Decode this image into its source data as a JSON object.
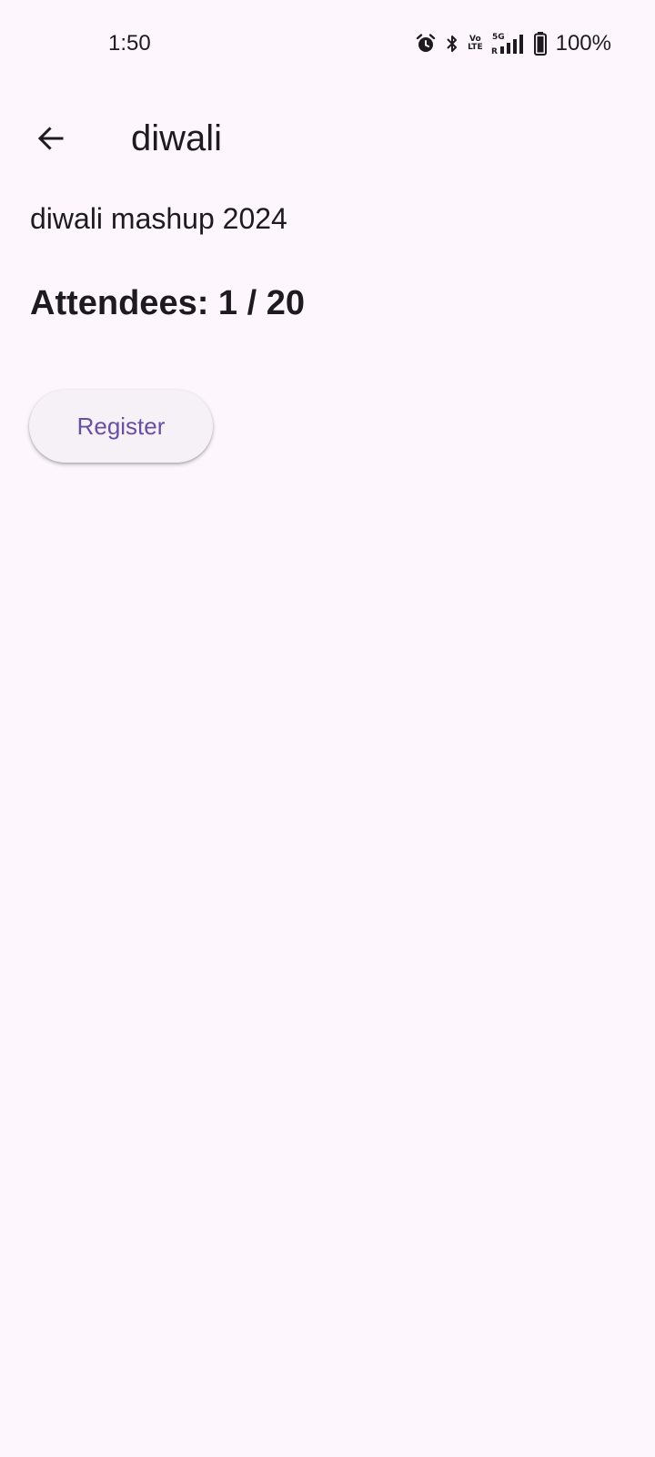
{
  "status_bar": {
    "time": "1:50",
    "battery": "100%",
    "icons": [
      "alarm-icon",
      "bluetooth-icon",
      "volte-icon",
      "signal-5g-icon",
      "battery-icon"
    ],
    "volte_top": "Vo",
    "volte_bottom": "LTE"
  },
  "app_bar": {
    "back_icon": "arrow-back-icon",
    "title": "diwali"
  },
  "event": {
    "description": "diwali mashup 2024",
    "attendees_label": "Attendees: 1 / 20"
  },
  "actions": {
    "register_label": "Register"
  },
  "colors": {
    "background": "#fdf7fd",
    "text": "#1d1b20",
    "accent": "#6750a4",
    "button_surface": "#f6f1f7"
  }
}
